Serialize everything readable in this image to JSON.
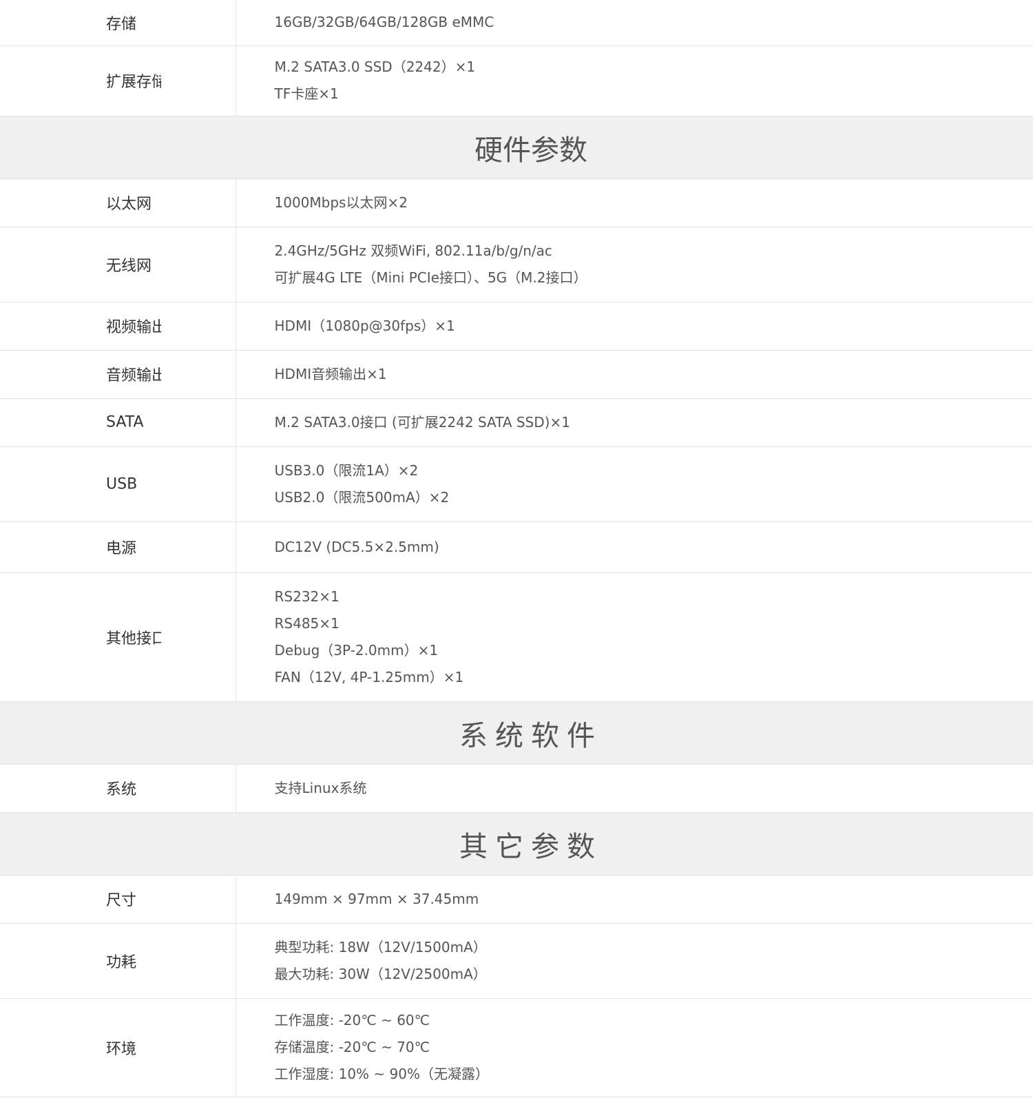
{
  "rows": [
    {
      "label": "存储",
      "values": [
        "16GB/32GB/64GB/128GB eMMC"
      ]
    },
    {
      "label": "扩展存储",
      "values": [
        "M.2 SATA3.0 SSD（2242）×1",
        "TF卡座×1"
      ]
    },
    {
      "section": "硬件参数"
    },
    {
      "label": "以太网",
      "values": [
        "1000Mbps以太网×2"
      ]
    },
    {
      "label": "无线网",
      "values": [
        "2.4GHz/5GHz 双频WiFi, 802.11a/b/g/n/ac",
        "可扩展4G LTE（Mini PCIe接口）、5G（M.2接口）"
      ]
    },
    {
      "label": "视频输出",
      "values": [
        "HDMI（1080p@30fps）×1"
      ]
    },
    {
      "label": "音频输出",
      "values": [
        "HDMI音频输出×1"
      ]
    },
    {
      "label": "SATA",
      "values": [
        "M.2 SATA3.0接口 (可扩展2242 SATA SSD)×1"
      ]
    },
    {
      "label": "USB",
      "values": [
        "USB3.0（限流1A）×2",
        "USB2.0（限流500mA）×2"
      ]
    },
    {
      "label": "电源",
      "values": [
        "DC12V (DC5.5×2.5mm)"
      ]
    },
    {
      "label": "其他接口",
      "values": [
        "RS232×1",
        "RS485×1",
        "Debug（3P-2.0mm）×1",
        "FAN（12V, 4P-1.25mm）×1"
      ]
    },
    {
      "section": "系统软件"
    },
    {
      "label": "系统",
      "values": [
        "支持Linux系统"
      ]
    },
    {
      "section": "其它参数"
    },
    {
      "label": "尺寸",
      "values": [
        "149mm × 97mm × 37.45mm"
      ]
    },
    {
      "label": "功耗",
      "values": [
        "典型功耗: 18W（12V/1500mA）",
        "最大功耗: 30W（12V/2500mA）"
      ]
    },
    {
      "label": "环境",
      "values": [
        "工作温度: -20℃ ~ 60℃",
        "存储温度: -20℃ ~ 70℃",
        "工作湿度: 10% ~ 90%（无凝露）"
      ]
    }
  ]
}
